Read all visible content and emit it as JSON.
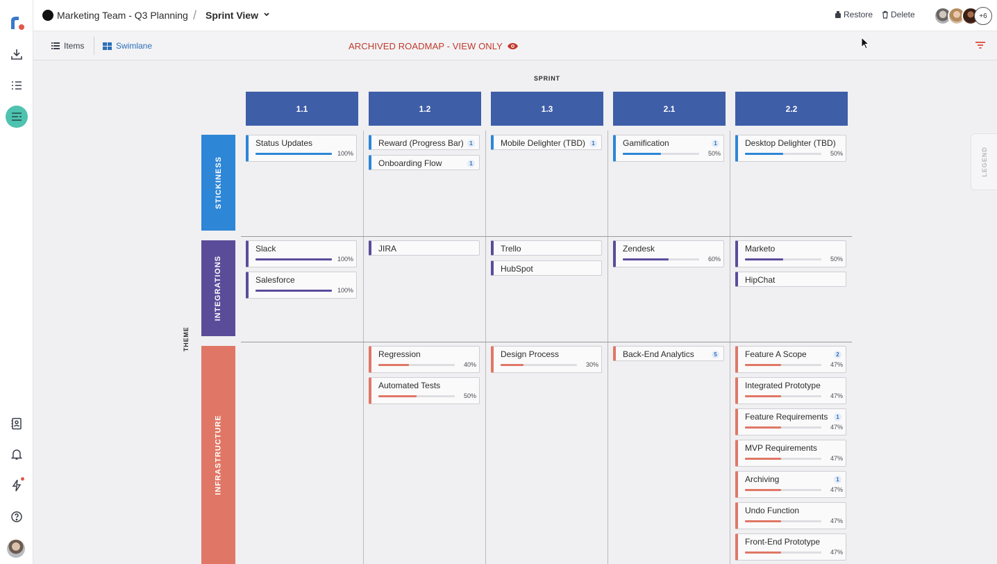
{
  "header": {
    "project_name": "Marketing Team - Q3 Planning",
    "separator": "/",
    "view_name": "Sprint View",
    "restore_label": "Restore",
    "delete_label": "Delete",
    "more_collaborators": "+6"
  },
  "subbar": {
    "tab_items": "Items",
    "tab_swimlane": "Swimlane",
    "archived_notice": "ARCHIVED ROADMAP - VIEW ONLY"
  },
  "board": {
    "sprint_axis": "SPRINT",
    "theme_axis": "THEME",
    "columns": [
      "1.1",
      "1.2",
      "1.3",
      "2.1",
      "2.2"
    ],
    "lanes": [
      {
        "name": "STICKINESS",
        "color": "#2d86d6"
      },
      {
        "name": "INTEGRATIONS",
        "color": "#5b4c9a"
      },
      {
        "name": "INFRASTRUCTURE",
        "color": "#e07766"
      }
    ],
    "legend_label": "LEGEND"
  },
  "cards": [
    {
      "title": "Status Updates",
      "lane": 0,
      "col": 0,
      "slot": 0,
      "progress": 100,
      "pct": "100%",
      "badge": ""
    },
    {
      "title": "Reward (Progress Bar)",
      "lane": 0,
      "col": 1,
      "slot": 0,
      "progress": null,
      "pct": "",
      "badge": "1"
    },
    {
      "title": "Onboarding Flow",
      "lane": 0,
      "col": 1,
      "slot": 1,
      "progress": null,
      "pct": "",
      "badge": "1"
    },
    {
      "title": "Mobile Delighter (TBD)",
      "lane": 0,
      "col": 2,
      "slot": 0,
      "progress": null,
      "pct": "",
      "badge": "1"
    },
    {
      "title": "Gamification",
      "lane": 0,
      "col": 3,
      "slot": 0,
      "progress": 50,
      "pct": "50%",
      "badge": "1"
    },
    {
      "title": "Desktop Delighter (TBD)",
      "lane": 0,
      "col": 4,
      "slot": 0,
      "progress": 50,
      "pct": "50%",
      "badge": ""
    },
    {
      "title": "Slack",
      "lane": 1,
      "col": 0,
      "slot": 0,
      "progress": 100,
      "pct": "100%",
      "badge": ""
    },
    {
      "title": "Salesforce",
      "lane": 1,
      "col": 0,
      "slot": 1,
      "progress": 100,
      "pct": "100%",
      "badge": ""
    },
    {
      "title": "JIRA",
      "lane": 1,
      "col": 1,
      "slot": 0,
      "progress": null,
      "pct": "",
      "badge": ""
    },
    {
      "title": "Trello",
      "lane": 1,
      "col": 2,
      "slot": 0,
      "progress": null,
      "pct": "",
      "badge": ""
    },
    {
      "title": "HubSpot",
      "lane": 1,
      "col": 2,
      "slot": 1,
      "progress": null,
      "pct": "",
      "badge": ""
    },
    {
      "title": "Zendesk",
      "lane": 1,
      "col": 3,
      "slot": 0,
      "progress": 60,
      "pct": "60%",
      "badge": ""
    },
    {
      "title": "Marketo",
      "lane": 1,
      "col": 4,
      "slot": 0,
      "progress": 50,
      "pct": "50%",
      "badge": ""
    },
    {
      "title": "HipChat",
      "lane": 1,
      "col": 4,
      "slot": 1,
      "progress": null,
      "pct": "",
      "badge": ""
    },
    {
      "title": "Regression",
      "lane": 2,
      "col": 1,
      "slot": 0,
      "progress": 40,
      "pct": "40%",
      "badge": ""
    },
    {
      "title": "Automated Tests",
      "lane": 2,
      "col": 1,
      "slot": 1,
      "progress": 50,
      "pct": "50%",
      "badge": ""
    },
    {
      "title": "Design Process",
      "lane": 2,
      "col": 2,
      "slot": 0,
      "progress": 30,
      "pct": "30%",
      "badge": ""
    },
    {
      "title": "Back-End Analytics",
      "lane": 2,
      "col": 3,
      "slot": 0,
      "progress": null,
      "pct": "",
      "badge": "5"
    },
    {
      "title": "Feature A Scope",
      "lane": 2,
      "col": 4,
      "slot": 0,
      "progress": 47,
      "pct": "47%",
      "badge": "2"
    },
    {
      "title": "Integrated Prototype",
      "lane": 2,
      "col": 4,
      "slot": 1,
      "progress": 47,
      "pct": "47%",
      "badge": ""
    },
    {
      "title": "Feature Requirements",
      "lane": 2,
      "col": 4,
      "slot": 2,
      "progress": 47,
      "pct": "47%",
      "badge": "1"
    },
    {
      "title": "MVP Requirements",
      "lane": 2,
      "col": 4,
      "slot": 3,
      "progress": 47,
      "pct": "47%",
      "badge": ""
    },
    {
      "title": "Archiving",
      "lane": 2,
      "col": 4,
      "slot": 4,
      "progress": 47,
      "pct": "47%",
      "badge": "1"
    },
    {
      "title": "Undo Function",
      "lane": 2,
      "col": 4,
      "slot": 5,
      "progress": 47,
      "pct": "47%",
      "badge": ""
    },
    {
      "title": "Front-End Prototype",
      "lane": 2,
      "col": 4,
      "slot": 6,
      "progress": 47,
      "pct": "47%",
      "badge": ""
    }
  ],
  "icons": {
    "sidebar": [
      "logo",
      "download-icon",
      "list-icon",
      "roadmap-icon",
      "contacts-icon",
      "bell-icon",
      "lightning-icon",
      "help-icon"
    ],
    "accent": "#4fc2b0",
    "alert": "#c0392b"
  }
}
